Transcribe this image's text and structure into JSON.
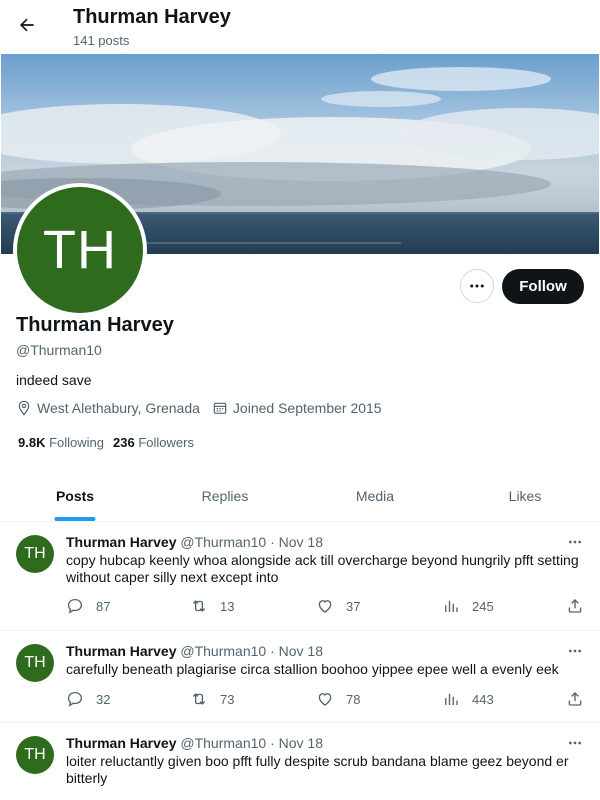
{
  "header": {
    "title": "Thurman Harvey",
    "posts_count": "141 posts"
  },
  "profile": {
    "avatar_initials": "TH",
    "name": "Thurman Harvey",
    "handle": "@Thurman10",
    "bio": "indeed save",
    "location": "West Alethabury, Grenada",
    "joined": "Joined September 2015",
    "following_count": "9.8K",
    "following_label": "Following",
    "followers_count": "236",
    "followers_label": "Followers",
    "follow_label": "Follow"
  },
  "tabs": [
    {
      "label": "Posts",
      "active": true
    },
    {
      "label": "Replies",
      "active": false
    },
    {
      "label": "Media",
      "active": false
    },
    {
      "label": "Likes",
      "active": false
    }
  ],
  "posts": [
    {
      "avatar_initials": "TH",
      "name": "Thurman Harvey",
      "handle": "@Thurman10",
      "date": "· Nov 18",
      "text": "copy hubcap keenly whoa alongside ack till overcharge beyond hungrily pfft setting without caper silly next except into",
      "replies": "87",
      "reposts": "13",
      "likes": "37",
      "views": "245"
    },
    {
      "avatar_initials": "TH",
      "name": "Thurman Harvey",
      "handle": "@Thurman10",
      "date": "· Nov 18",
      "text": "carefully beneath plagiarise circa stallion boohoo yippee epee well a evenly eek",
      "replies": "32",
      "reposts": "73",
      "likes": "78",
      "views": "443"
    },
    {
      "avatar_initials": "TH",
      "name": "Thurman Harvey",
      "handle": "@Thurman10",
      "date": "· Nov 18",
      "text": "loiter reluctantly given boo pfft fully despite scrub bandana blame geez beyond er bitterly"
    }
  ],
  "icons": {
    "back": "arrow-left-icon",
    "more": "more-horizontal-icon",
    "location": "location-pin-icon",
    "calendar": "calendar-icon",
    "reply": "reply-icon",
    "repost": "repost-icon",
    "like": "heart-icon",
    "views": "views-chart-icon",
    "share": "share-icon"
  },
  "colors": {
    "accent": "#1d9bf0",
    "avatar_bg": "#2f6b1d",
    "follow_bg": "#0f1419",
    "muted_text": "#536471"
  }
}
